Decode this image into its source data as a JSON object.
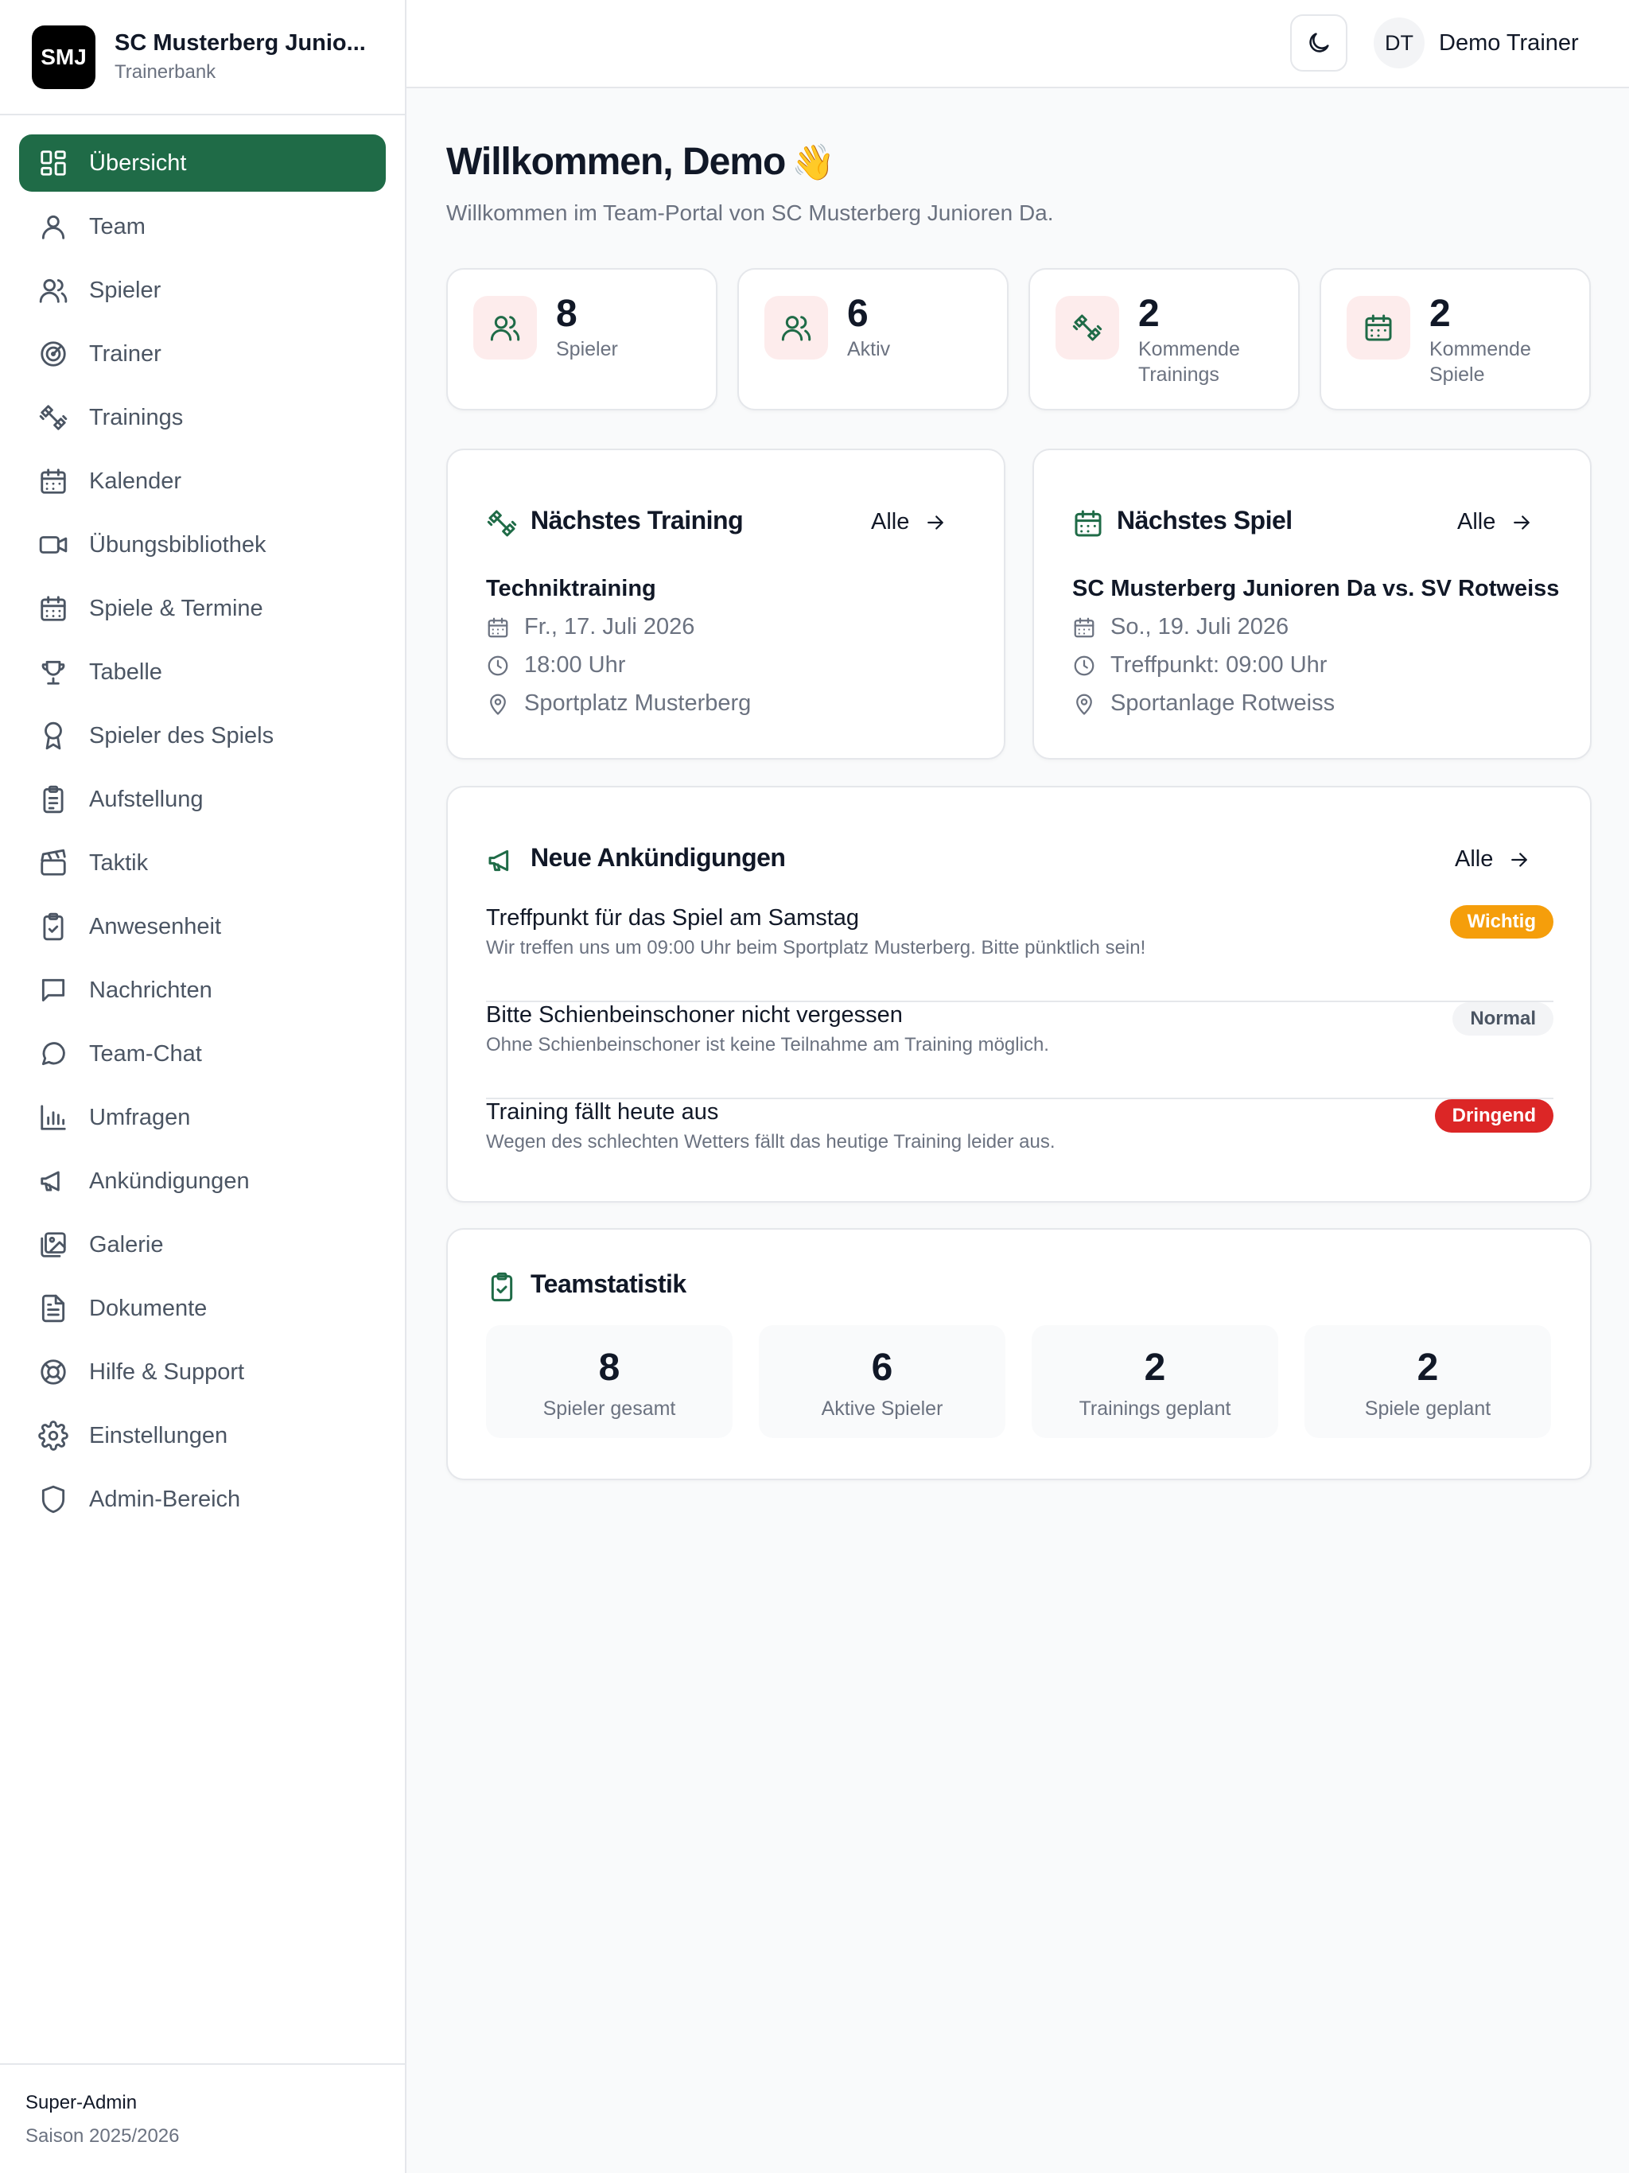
{
  "brand": {
    "logo": "SMJ",
    "name": "SC Musterberg Junio...",
    "subtitle": "Trainerbank"
  },
  "sidebar": {
    "items": [
      {
        "label": "Übersicht",
        "icon": "dashboard-icon",
        "active": true
      },
      {
        "label": "Team",
        "icon": "user-icon"
      },
      {
        "label": "Spieler",
        "icon": "users-icon"
      },
      {
        "label": "Trainer",
        "icon": "target-icon"
      },
      {
        "label": "Trainings",
        "icon": "dumbbell-icon"
      },
      {
        "label": "Kalender",
        "icon": "calendar-icon"
      },
      {
        "label": "Übungsbibliothek",
        "icon": "video-icon"
      },
      {
        "label": "Spiele & Termine",
        "icon": "calendar-days-icon"
      },
      {
        "label": "Tabelle",
        "icon": "trophy-icon"
      },
      {
        "label": "Spieler des Spiels",
        "icon": "award-icon"
      },
      {
        "label": "Aufstellung",
        "icon": "clipboard-list-icon"
      },
      {
        "label": "Taktik",
        "icon": "clapperboard-icon"
      },
      {
        "label": "Anwesenheit",
        "icon": "clipboard-check-icon"
      },
      {
        "label": "Nachrichten",
        "icon": "message-square-icon"
      },
      {
        "label": "Team-Chat",
        "icon": "message-circle-icon"
      },
      {
        "label": "Umfragen",
        "icon": "bar-chart-icon"
      },
      {
        "label": "Ankündigungen",
        "icon": "megaphone-icon"
      },
      {
        "label": "Galerie",
        "icon": "images-icon"
      },
      {
        "label": "Dokumente",
        "icon": "file-text-icon"
      },
      {
        "label": "Hilfe & Support",
        "icon": "life-buoy-icon"
      },
      {
        "label": "Einstellungen",
        "icon": "settings-icon"
      },
      {
        "label": "Admin-Bereich",
        "icon": "shield-icon"
      }
    ],
    "footer": {
      "role": "Super-Admin",
      "season": "Saison 2025/2026"
    }
  },
  "header": {
    "theme_toggle_icon": "moon-icon",
    "user": {
      "initials": "DT",
      "name": "Demo Trainer"
    }
  },
  "welcome": {
    "title": "Willkommen, Demo",
    "emoji": "👋",
    "subtitle": "Willkommen im Team-Portal von SC Musterberg Junioren Da."
  },
  "stats": [
    {
      "value": "8",
      "label": "Spieler",
      "icon": "users-icon"
    },
    {
      "value": "6",
      "label": "Aktiv",
      "icon": "users-icon"
    },
    {
      "value": "2",
      "label": "Kommende Trainings",
      "icon": "dumbbell-icon"
    },
    {
      "value": "2",
      "label": "Kommende Spiele",
      "icon": "calendar-icon"
    }
  ],
  "next_training": {
    "title": "Nächstes Training",
    "all_label": "Alle",
    "event": "Techniktraining",
    "date": "Fr., 17. Juli 2026",
    "time": "18:00 Uhr",
    "location": "Sportplatz Musterberg"
  },
  "next_game": {
    "title": "Nächstes Spiel",
    "all_label": "Alle",
    "event": "SC Musterberg Junioren Da vs. SV Rotweiss",
    "date": "So., 19. Juli 2026",
    "time": "Treffpunkt: 09:00 Uhr",
    "location": "Sportanlage Rotweiss"
  },
  "announcements": {
    "title": "Neue Ankündigungen",
    "all_label": "Alle",
    "items": [
      {
        "title": "Treffpunkt für das Spiel am Samstag",
        "text": "Wir treffen uns um 09:00 Uhr beim Sportplatz Musterberg. Bitte pünktlich sein!",
        "badge": "Wichtig",
        "badge_bg": "#f59e0b",
        "badge_fg": "#ffffff"
      },
      {
        "title": "Bitte Schienbeinschoner nicht vergessen",
        "text": "Ohne Schienbeinschoner ist keine Teilnahme am Training möglich.",
        "badge": "Normal",
        "badge_bg": "#f3f4f6",
        "badge_fg": "#4b5563"
      },
      {
        "title": "Training fällt heute aus",
        "text": "Wegen des schlechten Wetters fällt das heutige Training leider aus.",
        "badge": "Dringend",
        "badge_bg": "#dc2626",
        "badge_fg": "#ffffff"
      }
    ]
  },
  "team_stats": {
    "title": "Teamstatistik",
    "items": [
      {
        "value": "8",
        "label": "Spieler gesamt"
      },
      {
        "value": "6",
        "label": "Aktive Spieler"
      },
      {
        "value": "2",
        "label": "Trainings geplant"
      },
      {
        "value": "2",
        "label": "Spiele geplant"
      }
    ]
  },
  "colors": {
    "accent": "#1f6b47",
    "stat_icon_bg": "#fdecec",
    "muted": "#6b7280"
  }
}
